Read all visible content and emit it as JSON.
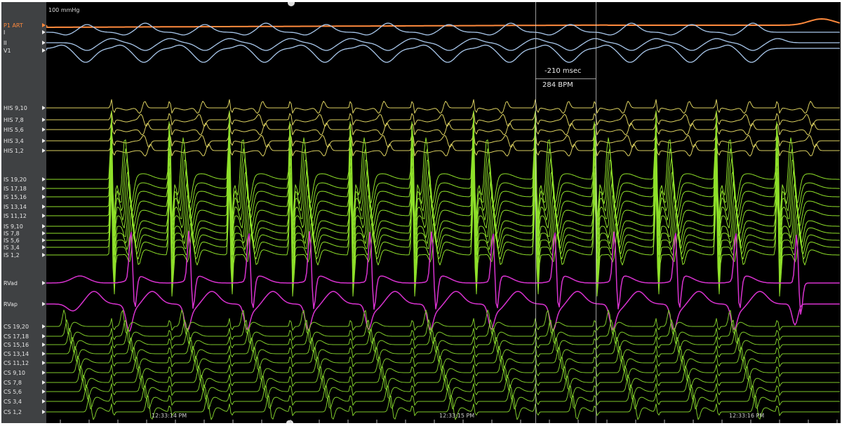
{
  "scale_label": "100 mmHg",
  "channels": [
    {
      "label": "P1 ART",
      "color": "#ff8a3d"
    },
    {
      "label": "I",
      "color": "#e6e6e6"
    },
    {
      "label": "II",
      "color": "#e6e6e6"
    },
    {
      "label": "V1",
      "color": "#e6e6e6"
    },
    {
      "label": "HIS 9,10",
      "color": "#e6e6e6"
    },
    {
      "label": "HIS 7,8",
      "color": "#e6e6e6"
    },
    {
      "label": "HIS 5,6",
      "color": "#e6e6e6"
    },
    {
      "label": "HIS 3,4",
      "color": "#e6e6e6"
    },
    {
      "label": "HIS 1,2",
      "color": "#e6e6e6"
    },
    {
      "label": "IS 19,20",
      "color": "#e6e6e6"
    },
    {
      "label": "IS 17,18",
      "color": "#e6e6e6"
    },
    {
      "label": "IS 15,16",
      "color": "#e6e6e6"
    },
    {
      "label": "IS 13,14",
      "color": "#e6e6e6"
    },
    {
      "label": "IS 11,12",
      "color": "#e6e6e6"
    },
    {
      "label": "IS 9,10",
      "color": "#e6e6e6"
    },
    {
      "label": "IS 7,8",
      "color": "#e6e6e6"
    },
    {
      "label": "IS 5,6",
      "color": "#e6e6e6"
    },
    {
      "label": "IS 3,4",
      "color": "#e6e6e6"
    },
    {
      "label": "IS 1,2",
      "color": "#e6e6e6"
    },
    {
      "label": "RVad",
      "color": "#e6e6e6"
    },
    {
      "label": "RVap",
      "color": "#e6e6e6"
    },
    {
      "label": "CS 19,20",
      "color": "#e6e6e6"
    },
    {
      "label": "CS 17,18",
      "color": "#e6e6e6"
    },
    {
      "label": "CS 15,16",
      "color": "#e6e6e6"
    },
    {
      "label": "CS 13,14",
      "color": "#e6e6e6"
    },
    {
      "label": "CS 11,12",
      "color": "#e6e6e6"
    },
    {
      "label": "CS 9,10",
      "color": "#e6e6e6"
    },
    {
      "label": "CS 7,8",
      "color": "#e6e6e6"
    },
    {
      "label": "CS 5,6",
      "color": "#e6e6e6"
    },
    {
      "label": "CS 3,4",
      "color": "#e6e6e6"
    },
    {
      "label": "CS 1,2",
      "color": "#e6e6e6"
    }
  ],
  "caliper": {
    "interval": "-210 msec",
    "rate": "284 BPM"
  },
  "timestamps": [
    "12:33:14 PM",
    "12:33:15 PM",
    "12:33:16 PM"
  ],
  "colors": {
    "art": "#ff8a3d",
    "surface_ecg": "#a9c8ec",
    "his": "#dcd160",
    "lv": "#8fe02a",
    "rv": "#d832cf",
    "cs": "#7ec82a",
    "background": "#000000",
    "sidebar": "#3f4143"
  }
}
